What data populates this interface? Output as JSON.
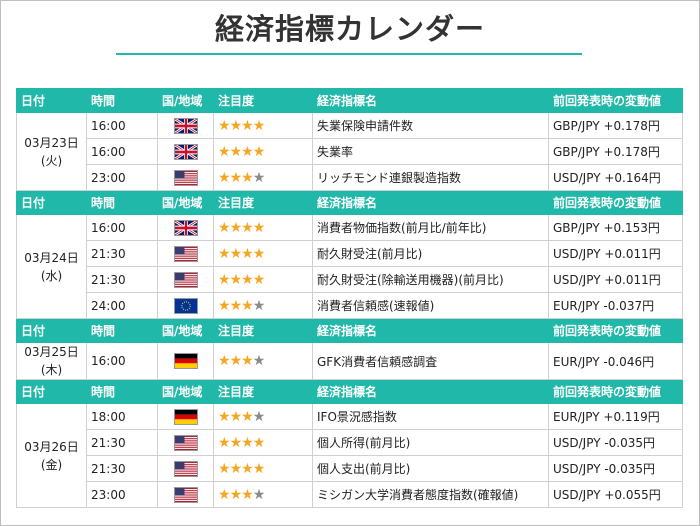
{
  "title": "経済指標カレンダー",
  "header": {
    "date": "日付",
    "time": "時間",
    "country": "国/地域",
    "importance": "注目度",
    "indicator": "経済指標名",
    "change": "前回発表時の変動値"
  },
  "colors": {
    "accent": "#20b8a8",
    "star_on": "#f5a623",
    "star_off": "#8a8a8a"
  },
  "days": [
    {
      "date_line1": "03月23日",
      "date_line2": "(火)",
      "rows": [
        {
          "time": "16:00",
          "flag": "uk-flag-icon",
          "stars": 4,
          "indicator": "失業保険申請件数",
          "change": "GBP/JPY +0.178円"
        },
        {
          "time": "16:00",
          "flag": "uk-flag-icon",
          "stars": 4,
          "indicator": "失業率",
          "change": "GBP/JPY +0.178円"
        },
        {
          "time": "23:00",
          "flag": "us-flag-icon",
          "stars": 3,
          "indicator": "リッチモンド連銀製造指数",
          "change": "USD/JPY +0.164円"
        }
      ]
    },
    {
      "date_line1": "03月24日",
      "date_line2": "(水)",
      "rows": [
        {
          "time": "16:00",
          "flag": "uk-flag-icon",
          "stars": 4,
          "indicator": "消費者物価指数(前月比/前年比)",
          "change": "GBP/JPY +0.153円"
        },
        {
          "time": "21:30",
          "flag": "us-flag-icon",
          "stars": 4,
          "indicator": "耐久財受注(前月比)",
          "change": "USD/JPY +0.011円"
        },
        {
          "time": "21:30",
          "flag": "us-flag-icon",
          "stars": 4,
          "indicator": "耐久財受注(除輸送用機器)(前月比)",
          "change": "USD/JPY +0.011円"
        },
        {
          "time": "24:00",
          "flag": "eu-flag-icon",
          "stars": 3,
          "indicator": "消費者信頼感(速報値)",
          "change": "EUR/JPY -0.037円"
        }
      ]
    },
    {
      "date_line1": "03月25日",
      "date_line2": "(木)",
      "rows": [
        {
          "time": "16:00",
          "flag": "de-flag-icon",
          "stars": 3,
          "indicator": "GFK消費者信頼感調査",
          "change": "EUR/JPY -0.046円"
        }
      ]
    },
    {
      "date_line1": "03月26日",
      "date_line2": "(金)",
      "rows": [
        {
          "time": "18:00",
          "flag": "de-flag-icon",
          "stars": 3,
          "indicator": "IFO景況感指数",
          "change": "EUR/JPY +0.119円"
        },
        {
          "time": "21:30",
          "flag": "us-flag-icon",
          "stars": 4,
          "indicator": "個人所得(前月比)",
          "change": "USD/JPY -0.035円"
        },
        {
          "time": "21:30",
          "flag": "us-flag-icon",
          "stars": 4,
          "indicator": "個人支出(前月比)",
          "change": "USD/JPY -0.035円"
        },
        {
          "time": "23:00",
          "flag": "us-flag-icon",
          "stars": 3,
          "indicator": "ミシガン大学消費者態度指数(確報値)",
          "change": "USD/JPY +0.055円"
        }
      ]
    }
  ]
}
